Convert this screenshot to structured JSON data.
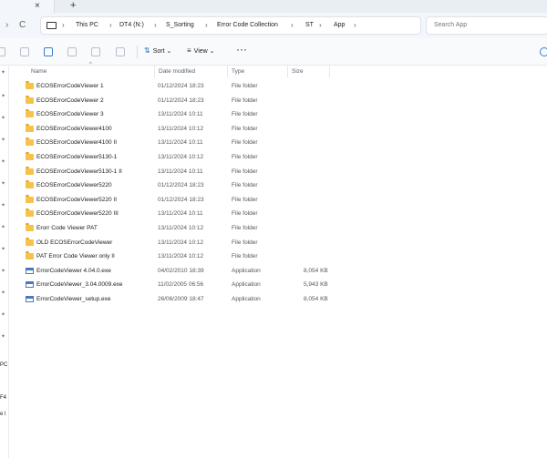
{
  "tabs": {
    "close_glyph": "×",
    "new_glyph": "+"
  },
  "nav": {
    "refresh_glyph": "C"
  },
  "breadcrumb": [
    {
      "label": "This PC"
    },
    {
      "label": "DT4 (N:)"
    },
    {
      "label": "S_Sorting"
    },
    {
      "label": "Error Code Collection"
    },
    {
      "label": "ST"
    },
    {
      "label": "App"
    }
  ],
  "breadcrumb_separator": "›",
  "search": {
    "placeholder": "Search App"
  },
  "toolbar": {
    "sort_label": "Sort",
    "view_label": "View",
    "more_label": "···",
    "chevron": "⌄"
  },
  "columns": {
    "name": "Name",
    "date": "Date modified",
    "type": "Type",
    "size": "Size",
    "sort_indicator": "^"
  },
  "nav_fragments": {
    "pc": "PC",
    "f4": "F4",
    "e": "e l"
  },
  "files": [
    {
      "name": "ECOSErrorCodeViewer 1",
      "date": "01/12/2024 18:23",
      "type": "File folder",
      "size": "",
      "kind": "folder"
    },
    {
      "name": "ECOSErrorCodeViewer 2",
      "date": "01/12/2024 18:23",
      "type": "File folder",
      "size": "",
      "kind": "folder"
    },
    {
      "name": "ECOSErrorCodeViewer 3",
      "date": "13/11/2024 10:11",
      "type": "File folder",
      "size": "",
      "kind": "folder"
    },
    {
      "name": "ECOSErrorCodeViewer4100",
      "date": "13/11/2024 10:12",
      "type": "File folder",
      "size": "",
      "kind": "folder"
    },
    {
      "name": "ECOSErrorCodeViewer4100 II",
      "date": "13/11/2024 10:11",
      "type": "File folder",
      "size": "",
      "kind": "folder"
    },
    {
      "name": "ECOSErrorCodeViewer5130-1",
      "date": "13/11/2024 10:12",
      "type": "File folder",
      "size": "",
      "kind": "folder"
    },
    {
      "name": "ECOSErrorCodeViewer5130-1 II",
      "date": "13/11/2024 10:11",
      "type": "File folder",
      "size": "",
      "kind": "folder"
    },
    {
      "name": "ECOSErrorCodeViewer5220",
      "date": "01/12/2024 18:23",
      "type": "File folder",
      "size": "",
      "kind": "folder"
    },
    {
      "name": "ECOSErrorCodeViewer5220 II",
      "date": "01/12/2024 18:23",
      "type": "File folder",
      "size": "",
      "kind": "folder"
    },
    {
      "name": "ECOSErrorCodeViewer5220 III",
      "date": "13/11/2024 10:11",
      "type": "File folder",
      "size": "",
      "kind": "folder"
    },
    {
      "name": "Erorr Code Viewer PAT",
      "date": "13/11/2024 10:12",
      "type": "File folder",
      "size": "",
      "kind": "folder"
    },
    {
      "name": "OLD ECOSErrorCodeViewer",
      "date": "13/11/2024 10:12",
      "type": "File folder",
      "size": "",
      "kind": "folder"
    },
    {
      "name": "PAT Error Code Viewer only II",
      "date": "13/11/2024 10:12",
      "type": "File folder",
      "size": "",
      "kind": "folder"
    },
    {
      "name": "ErrorCodeViewer 4.04.0.exe",
      "date": "04/02/2010 18:39",
      "type": "Application",
      "size": "8,054 KB",
      "kind": "exe"
    },
    {
      "name": "ErrorCodeViewer_3.04.0009.exe",
      "date": "11/02/2005 06:56",
      "type": "Application",
      "size": "5,943 KB",
      "kind": "exe"
    },
    {
      "name": "ErrorCodeViewer_setup.exe",
      "date": "26/06/2009 18:47",
      "type": "Application",
      "size": "8,054 KB",
      "kind": "exe"
    }
  ]
}
